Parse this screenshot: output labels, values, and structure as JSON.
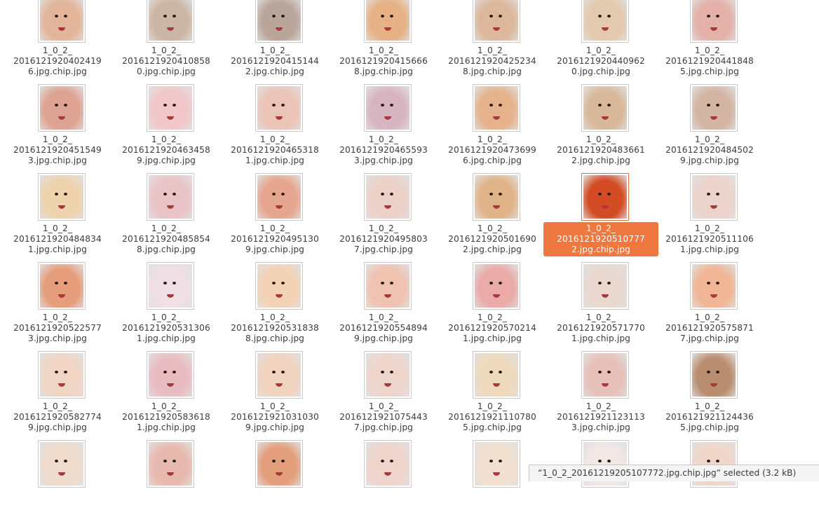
{
  "statusbar": {
    "text": "“1_0_2_20161219205107772.jpg.chip.jpg” selected (3.2 kB)"
  },
  "selected_file": "1_0_2_20161219205107772.jpg.chip.jpg",
  "colors": {
    "selection": "#ef7841",
    "label_text": "#3c3c3c",
    "statusbar_bg": "#f4f4f4"
  },
  "files": [
    {
      "l1": "1_0_2_",
      "l2": "2016121920402419",
      "l3": "6.jpg.chip.jpg",
      "tone": "#e2b59a"
    },
    {
      "l1": "1_0_2_",
      "l2": "2016121920410858",
      "l3": "0.jpg.chip.jpg",
      "tone": "#cbb5a4"
    },
    {
      "l1": "1_0_2_",
      "l2": "2016121920415144",
      "l3": "2.jpg.chip.jpg",
      "tone": "#b9a59a"
    },
    {
      "l1": "1_0_2_",
      "l2": "2016121920415666",
      "l3": "8.jpg.chip.jpg",
      "tone": "#e6b184"
    },
    {
      "l1": "1_0_2_",
      "l2": "2016121920425234",
      "l3": "8.jpg.chip.jpg",
      "tone": "#dcb79c"
    },
    {
      "l1": "1_0_2_",
      "l2": "2016121920440962",
      "l3": "0.jpg.chip.jpg",
      "tone": "#e3c9ad"
    },
    {
      "l1": "1_0_2_",
      "l2": "2016121920441848",
      "l3": "5.jpg.chip.jpg",
      "tone": "#e3b1a8"
    },
    {
      "l1": "1_0_2_",
      "l2": "2016121920451549",
      "l3": "3.jpg.chip.jpg",
      "tone": "#dda291"
    },
    {
      "l1": "1_0_2_",
      "l2": "2016121920463458",
      "l3": "9.jpg.chip.jpg",
      "tone": "#f2c7c9"
    },
    {
      "l1": "1_0_2_",
      "l2": "2016121920465318",
      "l3": "1.jpg.chip.jpg",
      "tone": "#ecc3b7"
    },
    {
      "l1": "1_0_2_",
      "l2": "2016121920465593",
      "l3": "3.jpg.chip.jpg",
      "tone": "#d8b4c0"
    },
    {
      "l1": "1_0_2_",
      "l2": "2016121920473699",
      "l3": "6.jpg.chip.jpg",
      "tone": "#e6b28c"
    },
    {
      "l1": "1_0_2_",
      "l2": "2016121920483661",
      "l3": "2.jpg.chip.jpg",
      "tone": "#d8b899"
    },
    {
      "l1": "1_0_2_",
      "l2": "2016121920484502",
      "l3": "9.jpg.chip.jpg",
      "tone": "#d4b4a2"
    },
    {
      "l1": "1_0_2_",
      "l2": "2016121920484834",
      "l3": "1.jpg.chip.jpg",
      "tone": "#eed3ad"
    },
    {
      "l1": "1_0_2_",
      "l2": "2016121920485854",
      "l3": "8.jpg.chip.jpg",
      "tone": "#eac3c6"
    },
    {
      "l1": "1_0_2_",
      "l2": "2016121920495130",
      "l3": "9.jpg.chip.jpg",
      "tone": "#e6a58e"
    },
    {
      "l1": "1_0_2_",
      "l2": "2016121920495803",
      "l3": "7.jpg.chip.jpg",
      "tone": "#ecd1c9"
    },
    {
      "l1": "1_0_2_",
      "l2": "2016121920501690",
      "l3": "2.jpg.chip.jpg",
      "tone": "#e1b388"
    },
    {
      "l1": "1_0_2_",
      "l2": "2016121920510777",
      "l3": "2.jpg.chip.jpg",
      "tone": "#c94e2a"
    },
    {
      "l1": "1_0_2_",
      "l2": "2016121920511106",
      "l3": "1.jpg.chip.jpg",
      "tone": "#ecd3cb"
    },
    {
      "l1": "1_0_2_",
      "l2": "2016121920522577",
      "l3": "3.jpg.chip.jpg",
      "tone": "#e59d7b"
    },
    {
      "l1": "1_0_2_",
      "l2": "2016121920531306",
      "l3": "1.jpg.chip.jpg",
      "tone": "#f0dfe4"
    },
    {
      "l1": "1_0_2_",
      "l2": "2016121920531838",
      "l3": "8.jpg.chip.jpg",
      "tone": "#f3d2b6"
    },
    {
      "l1": "1_0_2_",
      "l2": "2016121920554894",
      "l3": "9.jpg.chip.jpg",
      "tone": "#f0c2b0"
    },
    {
      "l1": "1_0_2_",
      "l2": "2016121920570214",
      "l3": "1.jpg.chip.jpg",
      "tone": "#e9aaa8"
    },
    {
      "l1": "1_0_2_",
      "l2": "2016121920571770",
      "l3": "1.jpg.chip.jpg",
      "tone": "#e8d8d0"
    },
    {
      "l1": "1_0_2_",
      "l2": "2016121920575871",
      "l3": "7.jpg.chip.jpg",
      "tone": "#f0b695"
    },
    {
      "l1": "1_0_2_",
      "l2": "2016121920582774",
      "l3": "9.jpg.chip.jpg",
      "tone": "#f1d5c4"
    },
    {
      "l1": "1_0_2_",
      "l2": "2016121920583618",
      "l3": "1.jpg.chip.jpg",
      "tone": "#e9bcc2"
    },
    {
      "l1": "1_0_2_",
      "l2": "2016121921031030",
      "l3": "9.jpg.chip.jpg",
      "tone": "#f1d3bf"
    },
    {
      "l1": "1_0_2_",
      "l2": "2016121921075443",
      "l3": "7.jpg.chip.jpg",
      "tone": "#eed5cc"
    },
    {
      "l1": "1_0_2_",
      "l2": "2016121921110780",
      "l3": "5.jpg.chip.jpg",
      "tone": "#eed9bd"
    },
    {
      "l1": "1_0_2_",
      "l2": "2016121921123113",
      "l3": "3.jpg.chip.jpg",
      "tone": "#e6c0b9"
    },
    {
      "l1": "1_0_2_",
      "l2": "2016121921124436",
      "l3": "5.jpg.chip.jpg",
      "tone": "#b98d70"
    },
    {
      "tone": "#f0dccd"
    },
    {
      "tone": "#e8b9ae"
    },
    {
      "tone": "#e39f7c"
    },
    {
      "tone": "#efd4cc"
    },
    {
      "tone": "#f2e1d0"
    },
    {
      "tone": "#f3e7e6"
    },
    {
      "tone": "#f0d6c9"
    }
  ]
}
